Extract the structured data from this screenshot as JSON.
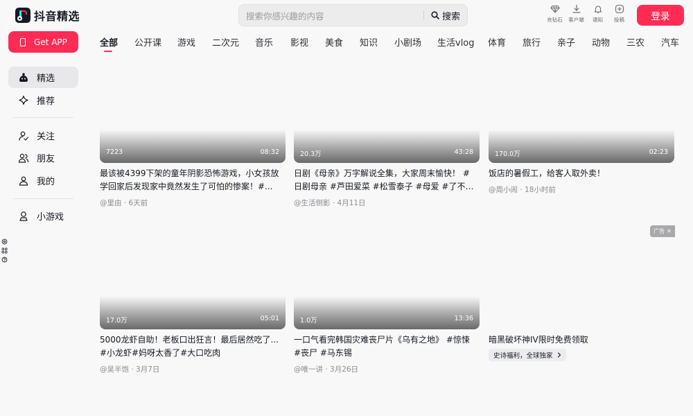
{
  "header": {
    "logo_text": "抖音精选",
    "search": {
      "placeholder": "搜索你感兴趣的内容",
      "button_label": "搜索"
    },
    "top_icons": [
      {
        "icon": "diamond-icon",
        "label": "充钻石"
      },
      {
        "icon": "download-icon",
        "label": "客户端"
      },
      {
        "icon": "bell-icon",
        "label": "通知"
      },
      {
        "icon": "plus-circle-icon",
        "label": "投稿"
      }
    ],
    "login_label": "登录"
  },
  "sidebar": {
    "get_app_label": "Get APP",
    "items": [
      {
        "icon": "featured-icon",
        "label": "精选"
      },
      {
        "icon": "sparkle-icon",
        "label": "推荐"
      },
      {
        "icon": "follow-icon",
        "label": "关注"
      },
      {
        "icon": "friends-icon",
        "label": "朋友"
      },
      {
        "icon": "profile-icon",
        "label": "我的"
      },
      {
        "icon": "minigame-icon",
        "label": "小游戏"
      }
    ],
    "mini_icons": [
      "settings-icon",
      "apps-icon",
      "help-icon"
    ]
  },
  "tabs": [
    "全部",
    "公开课",
    "游戏",
    "二次元",
    "音乐",
    "影视",
    "美食",
    "知识",
    "小剧场",
    "生活vlog",
    "体育",
    "旅行",
    "亲子",
    "动物",
    "三农",
    "汽车"
  ],
  "active_tab": "全部",
  "videos": [
    {
      "views": "7223",
      "duration": "08:32",
      "title_line1": "最该被4399下架的童年阴影恐怖游戏，小女孩放",
      "title_line2": "学回家后发现家中竟然发生了可怕的惨案！#...",
      "meta": "@里由 · 6天前"
    },
    {
      "views": "20.3万",
      "duration": "43:28",
      "title_line1": "日剧《母亲》万字解说全集，大家周末愉快！ #",
      "title_line2": "日剧母亲 #芦田爱菜 #松雪泰子 #母爱 #了不起...",
      "meta": "@生活侧影 · 4月11日"
    },
    {
      "views": "170.0万",
      "duration": "02:23",
      "title_line1": "饭店的暑假工，给客人取外卖！",
      "title_line2": "",
      "meta": "@周小闹 · 18小时前"
    },
    {
      "views": "17.0万",
      "duration": "05:01",
      "title_line1": "5000龙虾自助！老板口出狂言！最后居然吃了...",
      "title_line2": "#小龙虾#妈呀太香了#大口吃肉",
      "meta": "@吴半饱 · 3月7日"
    },
    {
      "views": "1.0万",
      "duration": "13:36",
      "title_line1": "一口气看完韩国灾难丧尸片《乌有之地》 #惊悚",
      "title_line2": "#丧尸 #马东锡",
      "meta": "@唯一讲 · 3月26日"
    }
  ],
  "ad": {
    "badge": "广告",
    "title": "暗黑破坏神IV限时免费领取",
    "chip": "史诗福利，全球独家"
  },
  "colors": {
    "accent": "#fe2c55",
    "text": "#161823",
    "background": "#f8f8f8"
  }
}
